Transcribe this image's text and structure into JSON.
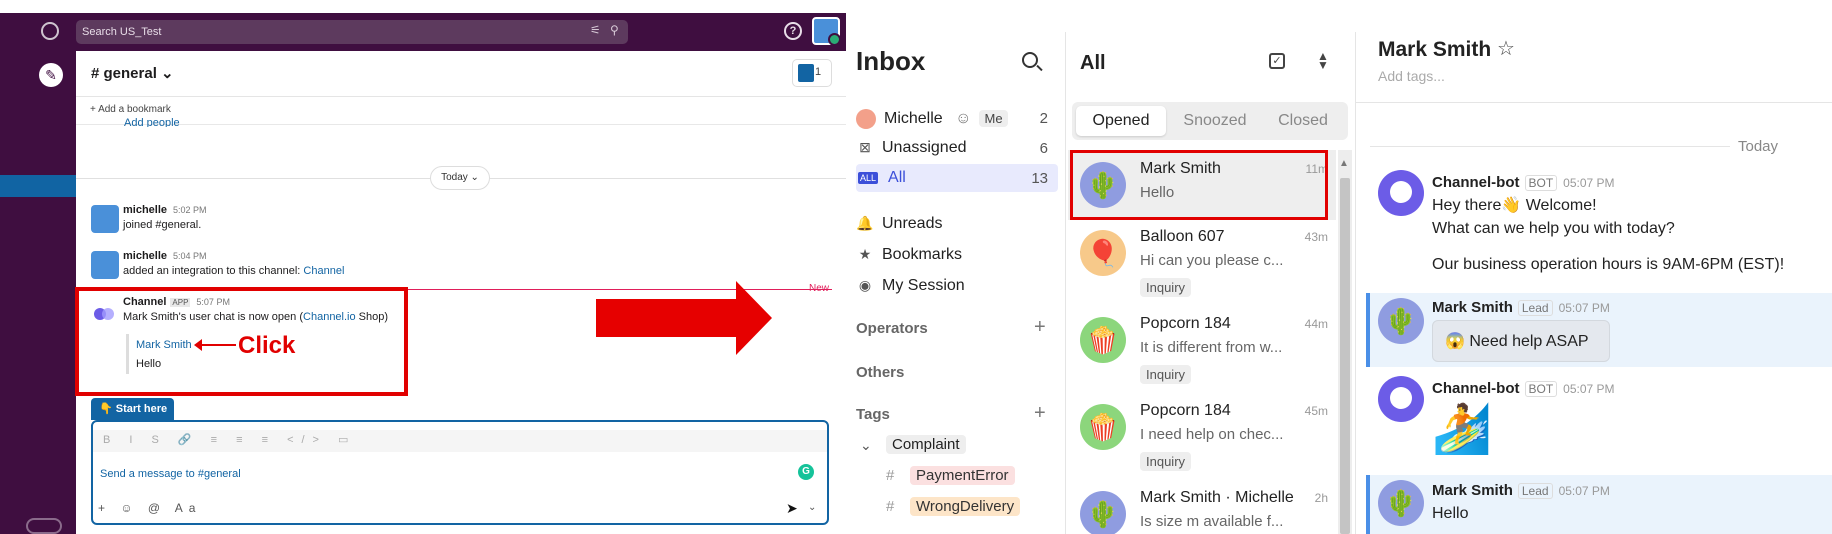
{
  "slack": {
    "search_placeholder": "Search US_Test",
    "help_label": "?",
    "channel_title": "# general ⌄",
    "member_count": "1",
    "add_bookmark": "+ Add a bookmark",
    "add_people": "Add people",
    "today_label": "Today ⌄",
    "new_label": "New",
    "messages": [
      {
        "name": "michelle",
        "time": "5:02 PM",
        "text": "joined #general."
      },
      {
        "name": "michelle",
        "time": "5:04 PM",
        "text": "added an integration to this channel: ",
        "link": "Channel"
      }
    ],
    "channel_msg": {
      "name": "Channel",
      "app_tag": "APP",
      "time": "5:07 PM",
      "text_before": "Mark Smith's user chat is now open (",
      "text_link": "Channel.io",
      "text_after": " Shop)",
      "quote_name": "Mark Smith",
      "quote_text": "Hello"
    },
    "click_label": "Click",
    "start_here": "👇 Start here",
    "composer_placeholder": "Send a message to #general",
    "format_icons": "B I S 🔗 ≡ ≡ ≡ </> ▭",
    "composer_tools": "+ ☺ @ Aa",
    "send_icon": "➤",
    "send_more_icon": "⌄",
    "grammarly": "G"
  },
  "inbox": {
    "title": "Inbox",
    "nav": [
      {
        "label": "Michelle",
        "count": "2",
        "me": "Me"
      },
      {
        "label": "Unassigned",
        "count": "6",
        "icon": "⊠"
      },
      {
        "label": "All",
        "count": "13",
        "icon": "ALL"
      },
      {
        "label": "Unreads",
        "icon": "🔔"
      },
      {
        "label": "Bookmarks",
        "icon": "★"
      },
      {
        "label": "My Session",
        "icon": "◉"
      }
    ],
    "operators": "Operators",
    "others": "Others",
    "tags": "Tags",
    "plus": "+",
    "complaint": "Complaint",
    "tag_items": [
      "PaymentError",
      "WrongDelivery"
    ],
    "hash": "#",
    "chevron": "⌄"
  },
  "list": {
    "title": "All",
    "tabs": [
      "Opened",
      "Snoozed",
      "Closed"
    ],
    "conversations": [
      {
        "name": "Mark Smith",
        "time": "11m",
        "preview": "Hello",
        "avatar": "🌵"
      },
      {
        "name": "Balloon 607",
        "time": "43m",
        "preview": "Hi can you please c...",
        "tag": "Inquiry",
        "avatar": "🎈"
      },
      {
        "name": "Popcorn 184",
        "time": "44m",
        "preview": "It is different from w...",
        "tag": "Inquiry",
        "avatar": "🍿"
      },
      {
        "name": "Popcorn 184",
        "time": "45m",
        "preview": "I need help on chec...",
        "tag": "Inquiry",
        "avatar": "🍿"
      },
      {
        "name": "Mark Smith · Michelle",
        "time": "2h",
        "preview": "Is size m available f...",
        "avatar": "🌵"
      }
    ]
  },
  "chat": {
    "name": "Mark Smith",
    "star": "☆",
    "add_tags": "Add tags...",
    "today": "Today",
    "messages": [
      {
        "name": "Channel-bot",
        "badge": "BOT",
        "time": "05:07 PM",
        "lines": [
          "Hey there👋 Welcome!",
          "What can we help you with today?",
          "Our business operation hours is 9AM-6PM (EST)!"
        ]
      },
      {
        "name": "Mark Smith",
        "badge": "Lead",
        "time": "05:07 PM",
        "button": "😱 Need help ASAP"
      },
      {
        "name": "Channel-bot",
        "badge": "BOT",
        "time": "05:07 PM",
        "sticker": "🏄"
      },
      {
        "name": "Mark Smith",
        "badge": "Lead",
        "time": "05:07 PM",
        "text": "Hello"
      }
    ]
  },
  "colors": {
    "slack_purple": "#3f0e40",
    "slack_blue": "#1264a3",
    "highlight_red": "#e10000",
    "channel_blue": "#3b4fd9"
  }
}
